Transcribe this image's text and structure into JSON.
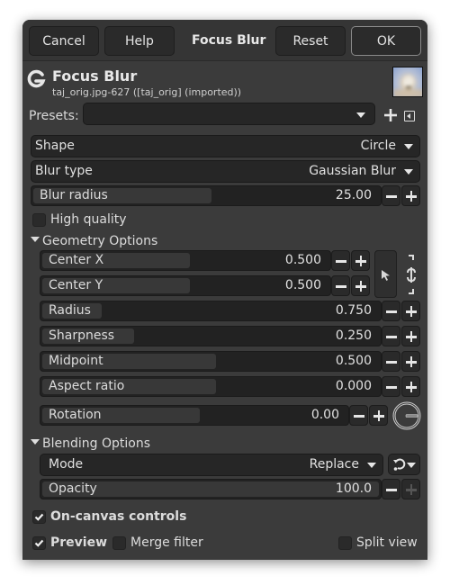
{
  "titlebar": {
    "cancel_label": "Cancel",
    "help_label": "Help",
    "title": "Focus Blur",
    "reset_label": "Reset",
    "ok_label": "OK"
  },
  "header": {
    "icon": "gimp-g-icon",
    "title": "Focus Blur",
    "subtitle": "taj_orig.jpg-627 ([taj_orig] (imported))",
    "thumbnail": "taj-mahal-thumbnail"
  },
  "presets": {
    "label": "Presets:",
    "value": "",
    "add_icon": "plus-icon",
    "menu_icon": "menu-triangle-icon"
  },
  "shape": {
    "label": "Shape",
    "value": "Circle"
  },
  "blur_type": {
    "label": "Blur type",
    "value": "Gaussian Blur"
  },
  "blur_radius": {
    "label": "Blur radius",
    "value": "25.00",
    "fill_fraction": 0.45
  },
  "high_quality": {
    "label": "High quality",
    "checked": false
  },
  "geometry": {
    "label": "Geometry Options",
    "expanded": true,
    "center_x": {
      "label": "Center X",
      "value": "0.500",
      "fill_fraction": 0.5
    },
    "center_y": {
      "label": "Center Y",
      "value": "0.500",
      "fill_fraction": 0.5
    },
    "radius": {
      "label": "Radius",
      "value": "0.750",
      "fill_fraction": 0.18
    },
    "sharpness": {
      "label": "Sharpness",
      "value": "0.250",
      "fill_fraction": 0.27
    },
    "midpoint": {
      "label": "Midpoint",
      "value": "0.500",
      "fill_fraction": 0.5
    },
    "aspect_ratio": {
      "label": "Aspect ratio",
      "value": "0.000",
      "fill_fraction": 0.5
    },
    "rotation": {
      "label": "Rotation",
      "value": "0.00",
      "fill_fraction": 0.5
    }
  },
  "blending": {
    "label": "Blending Options",
    "expanded": true,
    "mode": {
      "label": "Mode",
      "value": "Replace"
    },
    "opacity": {
      "label": "Opacity",
      "value": "100.0",
      "fill_fraction": 1.0
    }
  },
  "on_canvas_controls": {
    "label": "On-canvas controls",
    "checked": true
  },
  "preview": {
    "label": "Preview",
    "checked": true
  },
  "merge_filter": {
    "label": "Merge filter",
    "checked": false
  },
  "split_view": {
    "label": "Split view",
    "checked": false
  }
}
